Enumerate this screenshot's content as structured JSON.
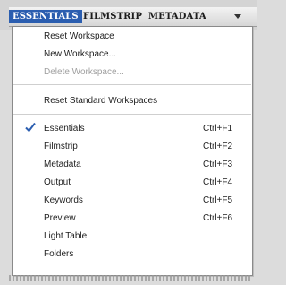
{
  "tabs": [
    {
      "label": "ESSENTIALS",
      "active": true
    },
    {
      "label": "FILMSTRIP",
      "active": false
    },
    {
      "label": "METADATA",
      "active": false
    }
  ],
  "tab_overflow_icon": "chevron-down-icon",
  "menu": {
    "workspace_items": [
      {
        "label": "Reset Workspace",
        "enabled": true
      },
      {
        "label": "New Workspace...",
        "enabled": true
      },
      {
        "label": "Delete Workspace...",
        "enabled": false
      }
    ],
    "reset_standard": {
      "label": "Reset Standard Workspaces"
    },
    "workspaces": [
      {
        "label": "Essentials",
        "shortcut": "Ctrl+F1",
        "checked": true
      },
      {
        "label": "Filmstrip",
        "shortcut": "Ctrl+F2",
        "checked": false
      },
      {
        "label": "Metadata",
        "shortcut": "Ctrl+F3",
        "checked": false
      },
      {
        "label": "Output",
        "shortcut": "Ctrl+F4",
        "checked": false
      },
      {
        "label": "Keywords",
        "shortcut": "Ctrl+F5",
        "checked": false
      },
      {
        "label": "Preview",
        "shortcut": "Ctrl+F6",
        "checked": false
      },
      {
        "label": "Light Table",
        "shortcut": "",
        "checked": false
      },
      {
        "label": "Folders",
        "shortcut": "",
        "checked": false
      }
    ]
  },
  "colors": {
    "active_tab": "#2b5eb0",
    "checkmark": "#2b5eb0",
    "disabled_text": "#a0a0a0"
  }
}
